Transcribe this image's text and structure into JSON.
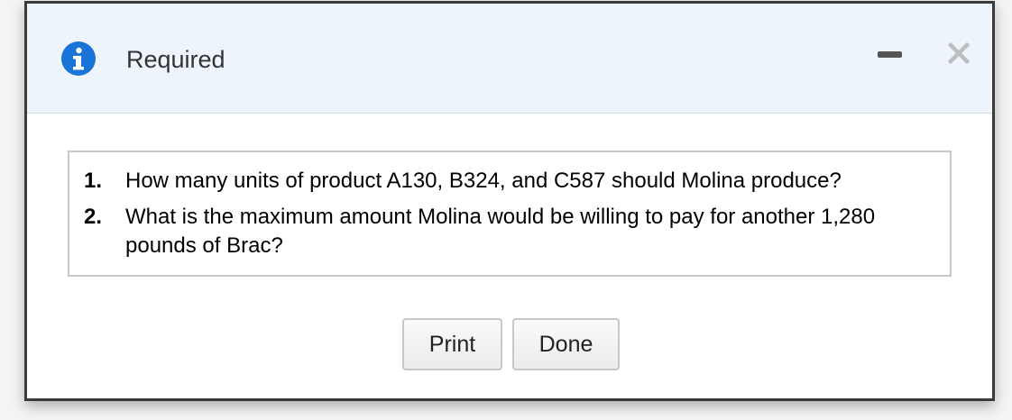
{
  "dialog": {
    "title": "Required",
    "icons": {
      "info": "info-icon",
      "minimize": "minimize-icon",
      "close": "close-icon"
    },
    "colors": {
      "header_background": "#eef4fc",
      "info_icon": "#1a73d6",
      "border": "#3a3a3a"
    }
  },
  "questions": [
    {
      "number": "1.",
      "text": "How many units of product A130, B324, and C587 should Molina produce?"
    },
    {
      "number": "2.",
      "text": "What is the maximum amount Molina would be willing to pay for another 1,280 pounds of Brac?"
    }
  ],
  "buttons": {
    "print_label": "Print",
    "done_label": "Done"
  }
}
